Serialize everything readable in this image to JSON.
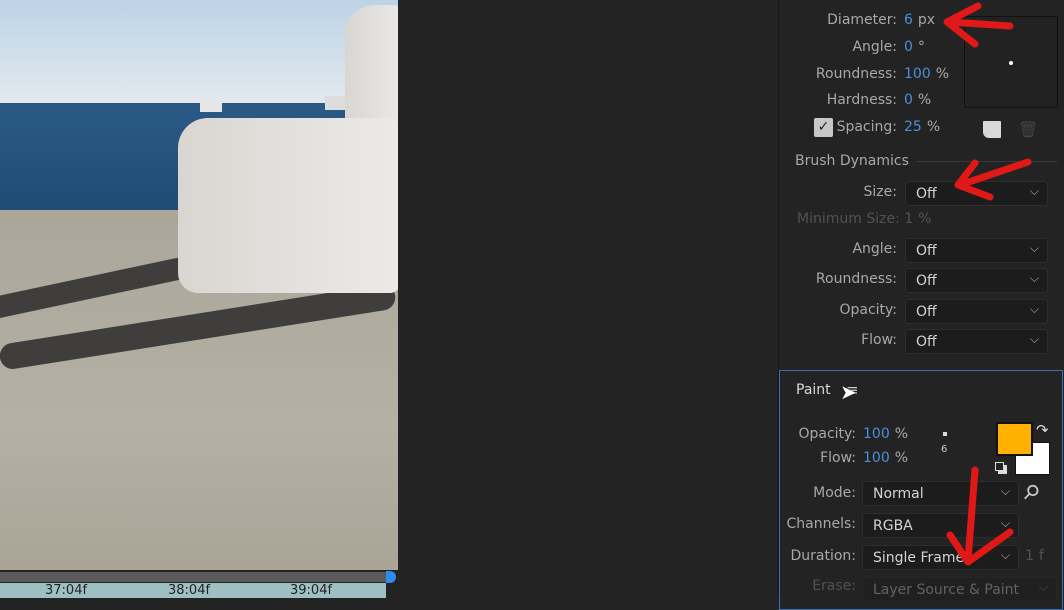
{
  "timeline": {
    "ticks": [
      "37:04f",
      "38:04f",
      "39:04f"
    ]
  },
  "brush_tips": {
    "diameter": {
      "label": "Diameter:",
      "value": "6",
      "unit": "px"
    },
    "angle": {
      "label": "Angle:",
      "value": "0",
      "unit": "°"
    },
    "roundness": {
      "label": "Roundness:",
      "value": "100",
      "unit": "%"
    },
    "hardness": {
      "label": "Hardness:",
      "value": "0",
      "unit": "%"
    },
    "spacing": {
      "label": "Spacing:",
      "value": "25",
      "unit": "%",
      "checked": true
    }
  },
  "brush_dynamics": {
    "title": "Brush Dynamics",
    "size": {
      "label": "Size:",
      "value": "Off"
    },
    "minimum_size": {
      "label": "Minimum Size:",
      "value": "1",
      "unit": "%"
    },
    "angle": {
      "label": "Angle:",
      "value": "Off"
    },
    "roundness": {
      "label": "Roundness:",
      "value": "Off"
    },
    "opacity": {
      "label": "Opacity:",
      "value": "Off"
    },
    "flow": {
      "label": "Flow:",
      "value": "Off"
    }
  },
  "paint": {
    "title": "Paint",
    "opacity": {
      "label": "Opacity:",
      "value": "100",
      "unit": "%"
    },
    "flow": {
      "label": "Flow:",
      "value": "100",
      "unit": "%"
    },
    "brush_size_preview": "6",
    "foreground_color": "#FFB000",
    "background_color": "#FFFFFF",
    "mode": {
      "label": "Mode:",
      "value": "Normal"
    },
    "channels": {
      "label": "Channels:",
      "value": "RGBA"
    },
    "duration": {
      "label": "Duration:",
      "value": "Single Frame",
      "frames": "1",
      "frames_unit": "f"
    },
    "erase": {
      "label": "Erase:",
      "value": "Layer Source & Paint"
    }
  },
  "annotation_color": "#E01818"
}
